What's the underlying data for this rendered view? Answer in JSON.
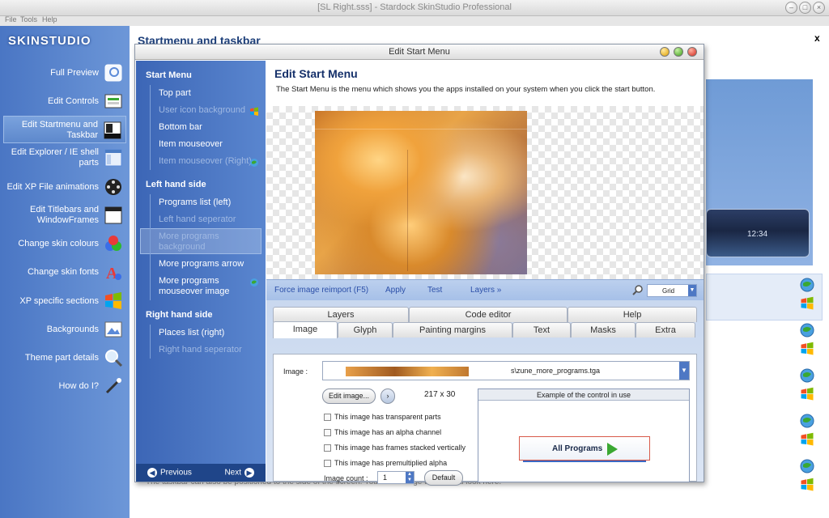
{
  "window": {
    "title": "[SL Right.sss] - Stardock SkinStudio Professional",
    "menu": [
      "File",
      "Tools",
      "Help"
    ]
  },
  "logo": {
    "text": "SKINSTUDIO"
  },
  "nav": [
    {
      "label": "Full Preview",
      "icon": "preview-icon"
    },
    {
      "label": "Edit Controls",
      "icon": "controls-icon"
    },
    {
      "label": "Edit Startmenu and Taskbar",
      "icon": "startmenu-icon",
      "selected": true
    },
    {
      "label": "Edit Explorer / IE shell parts",
      "icon": "explorer-icon"
    },
    {
      "label": "Edit XP File animations",
      "icon": "film-reel-icon"
    },
    {
      "label": "Edit Titlebars and WindowFrames",
      "icon": "window-frame-icon"
    },
    {
      "label": "Change skin colours",
      "icon": "color-balls-icon"
    },
    {
      "label": "Change skin fonts",
      "icon": "font-icon"
    },
    {
      "label": "XP specific sections",
      "icon": "windows-flag-icon"
    },
    {
      "label": "Backgrounds",
      "icon": "picture-icon"
    },
    {
      "label": "Theme part details",
      "icon": "magnifier-icon"
    },
    {
      "label": "How do I?",
      "icon": "wand-icon"
    }
  ],
  "main": {
    "heading": "Startmenu and taskbar",
    "close": "x",
    "bg_text": "The taskbar can also be positioned to the side of the screen.  You can change the vertical look here.",
    "clock": "12:34"
  },
  "dialog": {
    "title": "Edit Start Menu",
    "sections": [
      {
        "title": "Start Menu",
        "items": [
          {
            "label": "Top part",
            "disabled": false
          },
          {
            "label": "User icon background",
            "disabled": true
          },
          {
            "label": "Bottom bar",
            "disabled": false
          },
          {
            "label": "Item mouseover",
            "disabled": false
          },
          {
            "label": "Item mouseover (Right)",
            "disabled": true
          }
        ]
      },
      {
        "title": "Left hand side",
        "items": [
          {
            "label": "Programs list (left)",
            "disabled": false
          },
          {
            "label": "Left hand seperator",
            "disabled": true
          },
          {
            "label": "More programs background",
            "disabled": true,
            "selected": true
          },
          {
            "label": "More programs arrow",
            "disabled": false
          },
          {
            "label": "More programs mouseover image",
            "disabled": false
          }
        ]
      },
      {
        "title": "Right hand side",
        "items": [
          {
            "label": "Places list (right)",
            "disabled": false
          },
          {
            "label": "Right hand seperator",
            "disabled": true
          }
        ]
      }
    ],
    "footer": {
      "prev": "Previous",
      "next": "Next"
    },
    "edit_title": "Edit Start Menu",
    "edit_desc": "The Start Menu is the menu which shows you the apps installed on your system when you click the start button.",
    "actions": [
      "Force image reimport (F5)",
      "Apply",
      "Test",
      "Layers »"
    ],
    "grid_label": "Grid",
    "tabs_top": [
      "Layers",
      "Code editor",
      "Help"
    ],
    "tabs_bottom": [
      "Image",
      "Glyph",
      "Painting margins",
      "Text",
      "Masks",
      "Extra"
    ],
    "image_label": "Image :",
    "image_file": "s\\zune_more_programs.tga",
    "edit_image_button": "Edit image...",
    "dims": "217 x 30",
    "checkboxes": [
      "This image has transparent parts",
      "This image has an alpha channel",
      "This image has frames stacked vertically",
      "This image has premultiplied alpha"
    ],
    "image_count_label": "Image count :",
    "image_count": "1",
    "default_button": "Default",
    "example_title": "Example of the control in use",
    "example_button": "All Programs"
  },
  "colors": {
    "nav_bg": "#4a76c4",
    "accent": "#1d3f7a",
    "link": "#2b4fa8"
  }
}
